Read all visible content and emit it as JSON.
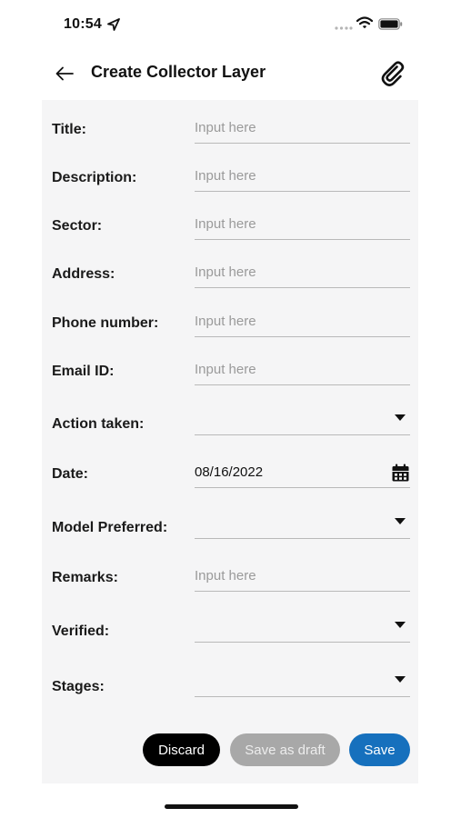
{
  "status_bar": {
    "time": "10:54"
  },
  "header": {
    "title": "Create Collector Layer"
  },
  "form": {
    "fields": [
      {
        "label": "Title:",
        "placeholder": "Input here"
      },
      {
        "label": "Description:",
        "placeholder": "Input here"
      },
      {
        "label": "Sector:",
        "placeholder": "Input here"
      },
      {
        "label": "Address:",
        "placeholder": "Input here"
      },
      {
        "label": "Phone number:",
        "placeholder": "Input here"
      },
      {
        "label": "Email ID:",
        "placeholder": "Input here"
      },
      {
        "label": "Action taken:",
        "value": ""
      },
      {
        "label": "Date:",
        "value": "08/16/2022"
      },
      {
        "label": "Model Preferred:",
        "value": ""
      },
      {
        "label": "Remarks:",
        "placeholder": "Input here"
      },
      {
        "label": "Verified:",
        "value": ""
      },
      {
        "label": "Stages:",
        "value": ""
      }
    ]
  },
  "actions": {
    "discard_label": "Discard",
    "draft_label": "Save as draft",
    "save_label": "Save"
  },
  "colors": {
    "save": "#1670bd",
    "draft": "#a8a8a8",
    "discard": "#000000",
    "panel": "#f5f5f6"
  }
}
